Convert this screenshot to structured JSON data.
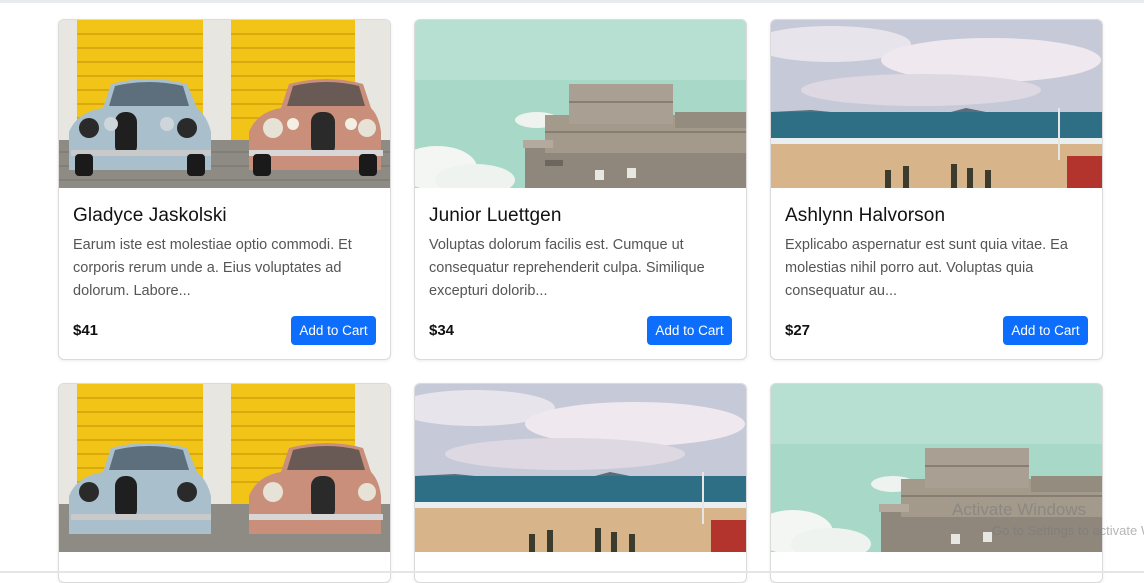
{
  "products": [
    {
      "image": "vintage-cars-photo",
      "title": "Gladyce Jaskolski",
      "description": "Earum iste est molestiae optio commodi. Et corporis rerum unde a. Eius voluptates ad dolorum. Labore...",
      "price": "$41",
      "button": "Add to Cart"
    },
    {
      "image": "concrete-building-photo",
      "title": "Junior Luettgen",
      "description": "Voluptas dolorum facilis est. Cumque ut consequatur reprehenderit culpa. Similique excepturi dolorib...",
      "price": "$34",
      "button": "Add to Cart"
    },
    {
      "image": "beach-photo",
      "title": "Ashlynn Halvorson",
      "description": "Explicabo aspernatur est sunt quia vitae. Ea molestias nihil porro aut. Voluptas quia consequatur au...",
      "price": "$27",
      "button": "Add to Cart"
    },
    {
      "image": "vintage-cars-photo"
    },
    {
      "image": "beach-photo"
    },
    {
      "image": "concrete-building-photo"
    }
  ],
  "watermark": {
    "title": "Activate Windows",
    "subtitle": "Go to Settings to activate Windows."
  },
  "colors": {
    "button": "#0d6efd",
    "garage_yellow": "#f2c418",
    "sky_teal": "#a8d8c8",
    "sea_blue": "#2e6f86",
    "sand": "#d8b48a"
  }
}
